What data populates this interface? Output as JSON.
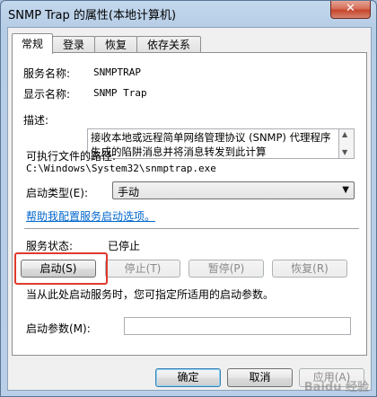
{
  "window": {
    "title": "SNMP Trap 的属性(本地计算机)",
    "close_label": "✕"
  },
  "tabs": [
    {
      "label": "常规",
      "active": true
    },
    {
      "label": "登录",
      "active": false
    },
    {
      "label": "恢复",
      "active": false
    },
    {
      "label": "依存关系",
      "active": false
    }
  ],
  "general": {
    "service_name_label": "服务名称:",
    "service_name": "SNMPTRAP",
    "display_name_label": "显示名称:",
    "display_name": "SNMP Trap",
    "description_label": "描述:",
    "description": "接收本地或远程简单网络管理协议 (SNMP) 代理程序生成的陷阱消息并将消息转发到此计算",
    "exec_path_label": "可执行文件的路径:",
    "exec_path": "C:\\Windows\\System32\\snmptrap.exe",
    "startup_type_label": "启动类型(E):",
    "startup_type": "手动",
    "help_link": "帮助我配置服务启动选项。",
    "status_label": "服务状态:",
    "status_value": "已停止",
    "start_button": "启动(S)",
    "stop_button": "停止(T)",
    "pause_button": "暂停(P)",
    "resume_button": "恢复(R)",
    "hint": "当从此处启动服务时，您可指定所适用的启动参数。",
    "params_label": "启动参数(M):",
    "params_value": ""
  },
  "footer": {
    "ok_button": "确定",
    "cancel_button": "取消",
    "apply_button": "应用(A)"
  },
  "watermark": "Baidu 经验"
}
